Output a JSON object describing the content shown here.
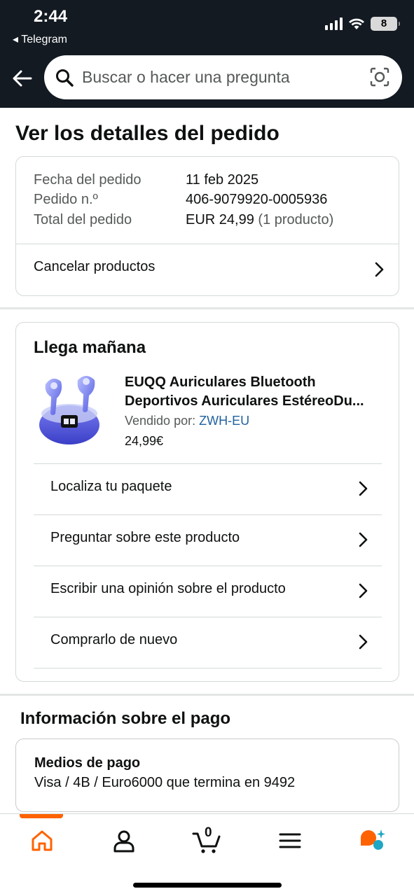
{
  "status_bar": {
    "time": "2:44",
    "back_app": "◂ Telegram",
    "battery": "8"
  },
  "search": {
    "placeholder": "Buscar o hacer una pregunta"
  },
  "page": {
    "title": "Ver los detalles del pedido"
  },
  "order_summary": {
    "date_label": "Fecha del pedido",
    "date_value": "11 feb 2025",
    "number_label": "Pedido n.º",
    "number_value": "406-9079920-0005936",
    "total_label": "Total del pedido",
    "total_value": "EUR 24,99",
    "total_count": "(1 producto)",
    "cancel_label": "Cancelar productos"
  },
  "shipment": {
    "title": "Llega mañana",
    "product": {
      "name_line1": "EUQQ Auriculares Bluetooth",
      "name_line2": "Deportivos Auriculares EstéreoDu...",
      "seller_label": "Vendido por:",
      "seller_name": "ZWH-EU",
      "price": "24,99€"
    },
    "actions": [
      {
        "label": "Localiza tu paquete"
      },
      {
        "label": "Preguntar sobre este producto"
      },
      {
        "label": "Escribir una opinión sobre el producto"
      },
      {
        "label": "Comprarlo de nuevo"
      }
    ]
  },
  "payment": {
    "section_title": "Información sobre el pago",
    "method_title": "Medios de pago",
    "method_value": "Visa / 4B / Euro6000  que termina en 9492"
  },
  "bottom_nav": {
    "items": [
      "home-icon",
      "account-icon",
      "cart-icon",
      "menu-icon",
      "rufus-icon"
    ],
    "cart_count": "0",
    "active_color": "#ff6200"
  },
  "colors": {
    "header_bg": "#131a22",
    "link": "#2162a1",
    "accent": "#ff6200"
  }
}
